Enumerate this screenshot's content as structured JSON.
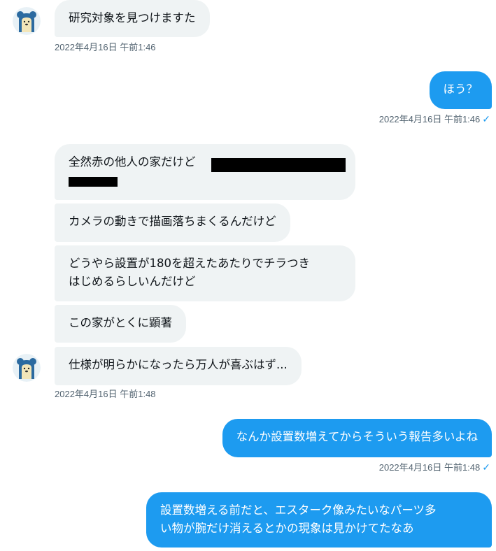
{
  "colors": {
    "sent_bubble": "#1d9bf0",
    "received_bubble": "#eff3f4",
    "timestamp": "#536471"
  },
  "messages": [
    {
      "from": "other",
      "text": "研究対象を見つけますた"
    },
    {
      "from": "other",
      "time": "2022年4月16日 午前1:46"
    },
    {
      "from": "me",
      "text": "ほう？"
    },
    {
      "from": "me",
      "time": "2022年4月16日 午前1:46"
    },
    {
      "from": "other",
      "text_line1": "全然赤の他人の家だけど",
      "text_line2": "",
      "redacted": true
    },
    {
      "from": "other",
      "text": "カメラの動きで描画落ちまくるんだけど"
    },
    {
      "from": "other",
      "text_line1": "どうやら設置が180を超えたあたりでチラつき",
      "text_line2": "はじめるらしいんだけど"
    },
    {
      "from": "other",
      "text": "この家がとくに顕著"
    },
    {
      "from": "other",
      "text": "仕様が明らかになったら万人が喜ぶはず..."
    },
    {
      "from": "other",
      "time": "2022年4月16日 午前1:48"
    },
    {
      "from": "me",
      "text": "なんか設置数増えてからそういう報告多いよね"
    },
    {
      "from": "me",
      "time": "2022年4月16日 午前1:48"
    },
    {
      "from": "me",
      "text_line1": "設置数増える前だと、エスターク像みたいなパーツ多",
      "text_line2": "い物が腕だけ消えるとかの現象は見かけてたなあ"
    }
  ],
  "icons": {
    "avatar": "bear-avatar-icon",
    "read": "checkmark-icon"
  }
}
